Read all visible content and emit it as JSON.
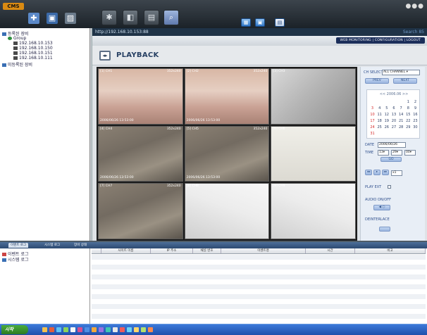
{
  "app": {
    "logo": "CMS",
    "window_controls": "●●●"
  },
  "toolbar_tabs": [
    {
      "name": "tab-live",
      "icon": "✱"
    },
    {
      "name": "tab-playback",
      "icon": "◧"
    },
    {
      "name": "tab-config",
      "icon": "▤"
    },
    {
      "name": "tab-search",
      "icon": "⌕"
    }
  ],
  "tree": {
    "root": "등록된 장비",
    "group": "Group",
    "devices": [
      "192.168.10.153",
      "192.168.10.150",
      "192.168.10.151",
      "192.168.10.111"
    ],
    "unregistered": "미등록된 장비"
  },
  "browser": {
    "url": "http://192.168.10.153:88",
    "search_label": "Search 85",
    "nav_strip": "WEB MONITORING  |  CONFIGURATION  |  LOGOUT",
    "page_title": "PLAYBACK"
  },
  "cameras": [
    {
      "tag": "[1] CH1",
      "res": "352x240",
      "ts": "2006/06/26 13:53:00",
      "scene": "dance"
    },
    {
      "tag": "[2] CH2",
      "res": "352x240",
      "ts": "2006/06/26 13:53:00",
      "scene": "dance"
    },
    {
      "tag": "[3] CH3",
      "res": "",
      "ts": "",
      "scene": "room"
    },
    {
      "tag": "[4] CH4",
      "res": "352x240",
      "ts": "2006/06/26 13:53:00",
      "scene": "parking"
    },
    {
      "tag": "[5] CH5",
      "res": "352x240",
      "ts": "2006/06/26 13:53:00",
      "scene": "parking"
    },
    {
      "tag": "[6] CH6",
      "res": "",
      "ts": "",
      "scene": "clockscene"
    },
    {
      "tag": "[7] CH7",
      "res": "352x240",
      "ts": "",
      "scene": "parking"
    },
    {
      "tag": "[8] CH8",
      "res": "",
      "ts": "",
      "scene": "glare"
    },
    {
      "tag": "[9] CH9",
      "res": "",
      "ts": "",
      "scene": "glare"
    }
  ],
  "controls": {
    "ch_select_label": "CH SELECT",
    "ch_select_value": "ALL CHANNEL",
    "btn_prev": "PREV",
    "btn_next": "NEXT",
    "calendar_header": "<<  2006.06  >>",
    "calendar_rows": [
      [
        "",
        "",
        "",
        "",
        "",
        "1",
        "2"
      ],
      [
        "3",
        "4",
        "5",
        "6",
        "7",
        "8",
        "9"
      ],
      [
        "10",
        "11",
        "12",
        "13",
        "14",
        "15",
        "16"
      ],
      [
        "17",
        "18",
        "19",
        "20",
        "21",
        "22",
        "23"
      ],
      [
        "24",
        "25",
        "26",
        "27",
        "28",
        "29",
        "30"
      ],
      [
        "31",
        "",
        "",
        "",
        "",
        "",
        ""
      ]
    ],
    "date_label": "DATE",
    "date_value": "2006/06/26",
    "time_label": "TIME",
    "time_h": "13",
    "time_m": "29",
    "time_s": "00",
    "go_label": "GO",
    "speed_value": "x1",
    "play_ext_label": "PLAY EXT",
    "audio_label": "AUDIO ON/OFF",
    "deinterlace_label": "DEINTERLACE"
  },
  "event_pane": {
    "tabs": [
      "이벤트 로그",
      "시스템 로그",
      "장비 상태"
    ],
    "tree_items": [
      "이벤트 로그",
      "시스템 로그"
    ],
    "columns": [
      "",
      "사이트 이름",
      "IP 주소",
      "채널 번호",
      "이벤트명",
      "시간",
      "비고"
    ]
  },
  "taskbar": {
    "start_label": "시작"
  }
}
